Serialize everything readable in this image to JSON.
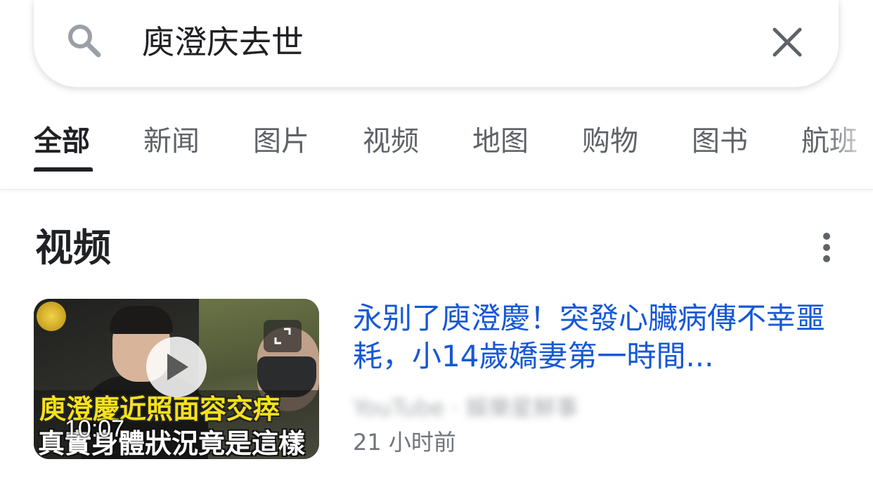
{
  "search": {
    "query": "庾澄庆去世"
  },
  "tabs": [
    {
      "label": "全部",
      "active": true
    },
    {
      "label": "新闻"
    },
    {
      "label": "图片"
    },
    {
      "label": "视频"
    },
    {
      "label": "地图"
    },
    {
      "label": "购物"
    },
    {
      "label": "图书"
    },
    {
      "label": "航班"
    }
  ],
  "videos_section": {
    "title": "视频",
    "items": [
      {
        "title": "永别了庾澄慶！突發心臟病傳不幸噩耗，小14歲嬌妻第一時間...",
        "source": "YouTube · 娛樂星鮮事",
        "time": "21 小时前",
        "duration": "10:07",
        "thumbnail_caption_line1": "庾澄慶近照面容交瘁",
        "thumbnail_caption_line2": "真實身體狀況竟是這樣"
      }
    ]
  },
  "colors": {
    "link_blue": "#1558d6",
    "text_primary": "#202124",
    "text_secondary": "#70757a",
    "tab_inactive": "#5f6368"
  },
  "icons": [
    "search-icon",
    "close-icon",
    "more-vert-icon",
    "play-icon",
    "expand-icon"
  ]
}
